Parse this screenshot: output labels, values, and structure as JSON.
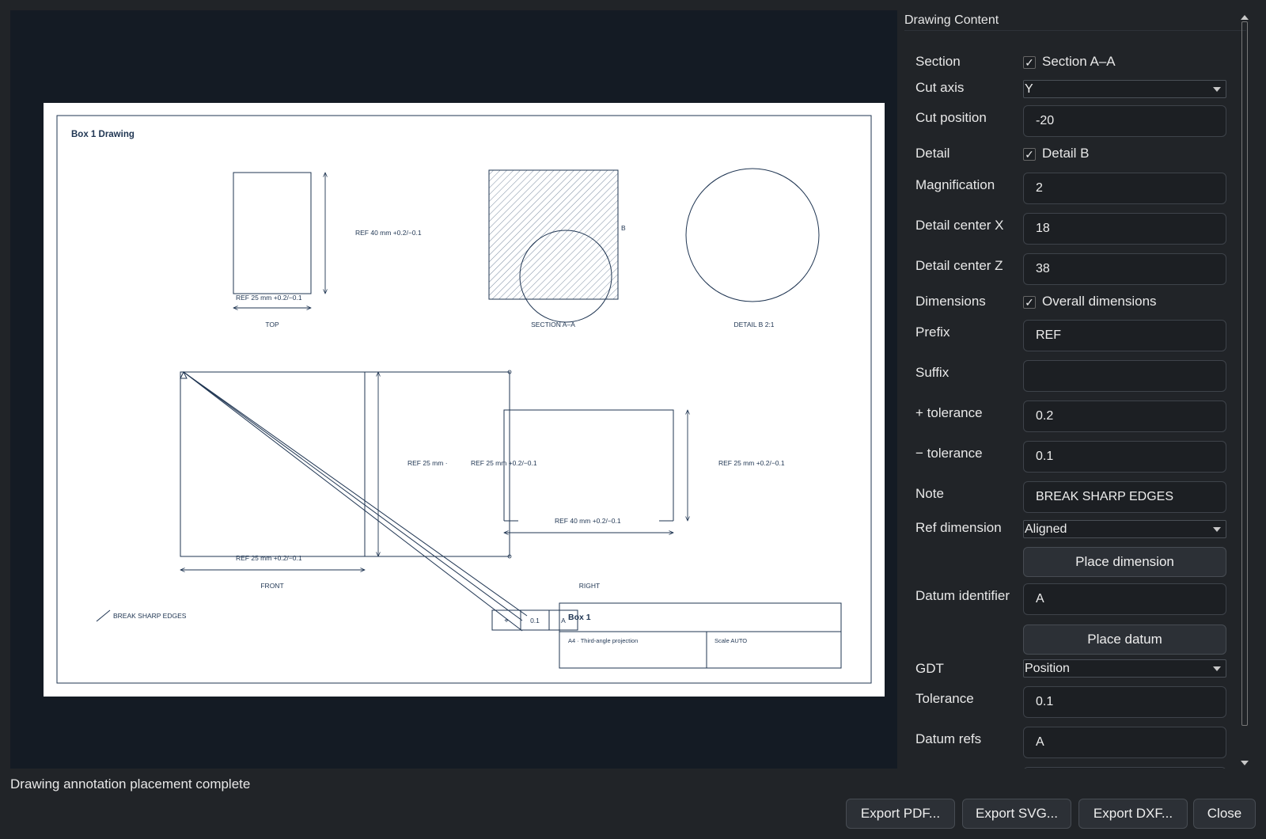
{
  "drawing": {
    "title": "Box 1 Drawing",
    "views": {
      "top": "TOP",
      "section": "SECTION A–A",
      "detail": "DETAIL B  2:1",
      "front": "FRONT",
      "right": "RIGHT"
    },
    "dims": {
      "top_vertical": "REF 40 mm  +0.2/−0.1",
      "top_horizontal": "REF 25 mm  +0.2/−0.1",
      "front_mid_left": "REF 25 mm  ·",
      "front_mid": "REF 25 mm  +0.2/−0.1",
      "right_side": "REF 25 mm  +0.2/−0.1",
      "right_horizontal": "REF 40 mm  +0.2/−0.1",
      "front_horizontal": "REF 25 mm  +0.2/−0.1"
    },
    "detail_marker": "B",
    "note": "BREAK SHARP EDGES",
    "fcf": {
      "symbol": "⌖",
      "tolerance": "0.1",
      "datum": "A"
    },
    "title_block": {
      "name": "Box 1",
      "sheet": "A4 · Third-angle projection",
      "scale": "Scale AUTO"
    }
  },
  "panel": {
    "title": "Drawing Content",
    "rows": {
      "section_label": "Section",
      "section_check": "Section A–A",
      "cut_axis_label": "Cut axis",
      "cut_axis_value": "Y",
      "cut_position_label": "Cut position",
      "cut_position_value": "-20",
      "detail_label": "Detail",
      "detail_check": "Detail B",
      "magnification_label": "Magnification",
      "magnification_value": "2",
      "detail_cx_label": "Detail center X",
      "detail_cx_value": "18",
      "detail_cz_label": "Detail center Z",
      "detail_cz_value": "38",
      "dimensions_label": "Dimensions",
      "dimensions_check": "Overall dimensions",
      "prefix_label": "Prefix",
      "prefix_value": "REF",
      "suffix_label": "Suffix",
      "suffix_value": "",
      "plus_tol_label": "+ tolerance",
      "plus_tol_value": "0.2",
      "minus_tol_label": "− tolerance",
      "minus_tol_value": "0.1",
      "note_label": "Note",
      "note_value": "BREAK SHARP EDGES",
      "ref_dim_label": "Ref dimension",
      "ref_dim_value": "Aligned",
      "place_dimension": "Place dimension",
      "datum_id_label": "Datum identifier",
      "datum_id_value": "A",
      "place_datum": "Place datum",
      "gdt_label": "GDT",
      "gdt_value": "Position",
      "tolerance_label": "Tolerance",
      "tolerance_value": "0.1",
      "datum_refs_label": "Datum refs",
      "datum_refs_value": "A"
    },
    "checkmark": "✓"
  },
  "status": "Drawing annotation placement complete",
  "buttons": {
    "export_pdf": "Export PDF...",
    "export_svg": "Export SVG...",
    "export_dxf": "Export DXF...",
    "close": "Close"
  }
}
